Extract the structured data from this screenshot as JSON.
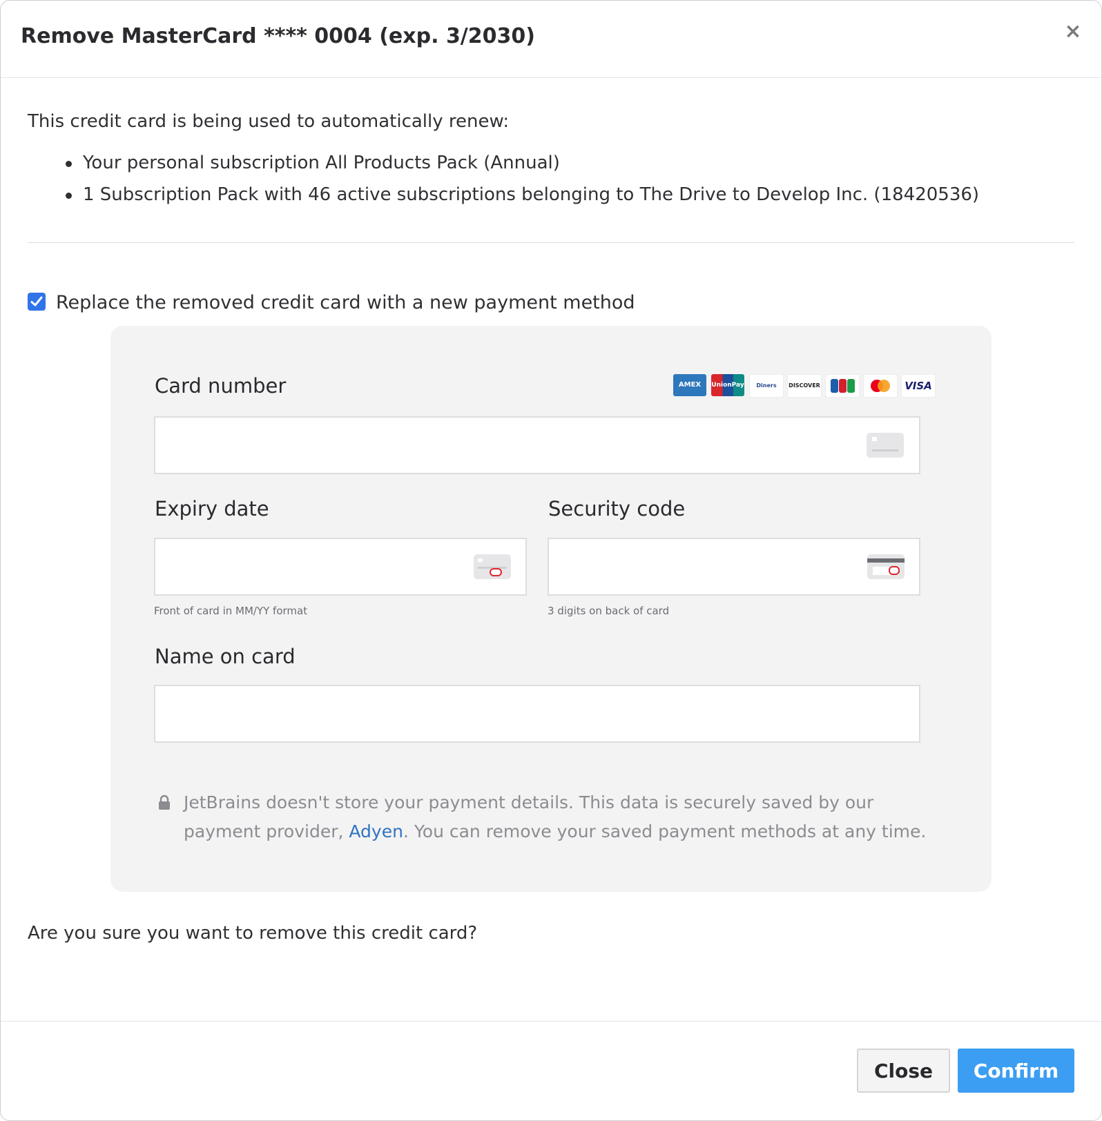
{
  "dialog": {
    "title": "Remove MasterCard **** 0004 (exp. 3/2030)",
    "close_glyph": "×"
  },
  "intro": "This credit card is being used to automatically renew:",
  "uses": [
    "Your personal subscription All Products Pack (Annual)",
    "1 Subscription Pack with 46 active subscriptions belonging to The Drive to Develop Inc. (18420536)"
  ],
  "replace": {
    "checked": true,
    "label": "Replace the removed credit card with a new payment method"
  },
  "card_form": {
    "card_number": {
      "label": "Card number",
      "value": ""
    },
    "expiry": {
      "label": "Expiry date",
      "value": "",
      "hint": "Front of card in MM/YY format"
    },
    "security": {
      "label": "Security code",
      "value": "",
      "hint": "3 digits on back of card"
    },
    "name": {
      "label": "Name on card",
      "value": ""
    },
    "brands": [
      "AMEX",
      "UnionPay",
      "Diners Club",
      "DISCOVER",
      "JCB",
      "MasterCard",
      "VISA"
    ],
    "note_before": "JetBrains doesn't store your payment details. This data is securely saved by our payment provider, ",
    "note_link": "Adyen",
    "note_after": ". You can remove your saved payment methods at any time."
  },
  "confirm_question": "Are you sure you want to remove this credit card?",
  "buttons": {
    "close": "Close",
    "confirm": "Confirm"
  },
  "colors": {
    "accent": "#3c9ef2",
    "checkbox": "#2f74e9",
    "link": "#2f74c0",
    "panel": "#f3f3f4"
  }
}
